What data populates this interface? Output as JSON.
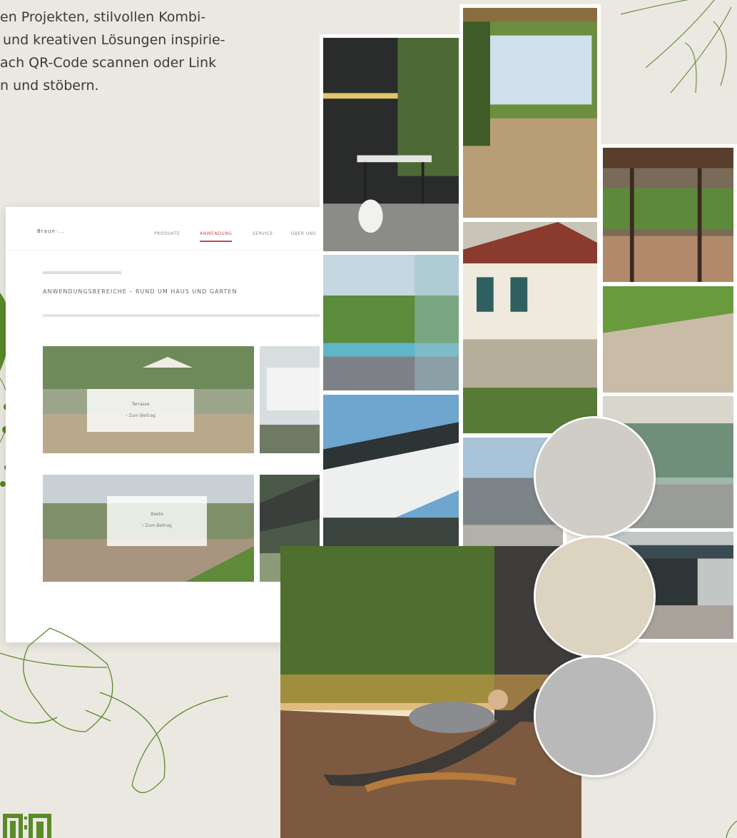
{
  "intro": {
    "lines": [
      "en Projekten, stilvollen Kombi-",
      "und kreativen Lösungen inspirie-",
      "ach QR-Code scannen oder Link",
      "n und stöbern."
    ]
  },
  "mockup": {
    "logo": "Braun·...",
    "menu": [
      "PRODUKTE",
      "ANWENDUNG",
      "SERVICE",
      "ÜBER UNS"
    ],
    "heading": "ANWENDUNGSBEREICHE – RUND UM HAUS UND GARTEN",
    "card_labels": [
      {
        "line1": "Terrasse",
        "line2": "› Zum Beitrag"
      },
      {
        "line1": "Beete",
        "line2": "› Zum Beitrag"
      }
    ]
  },
  "colors": {
    "background": "#ebe8e1",
    "deco_green": "#5a8a2a",
    "accent_red": "#c0504d"
  },
  "icons": [
    "leaf-line-icon",
    "dotted-branch-icon",
    "qr-code-icon"
  ]
}
